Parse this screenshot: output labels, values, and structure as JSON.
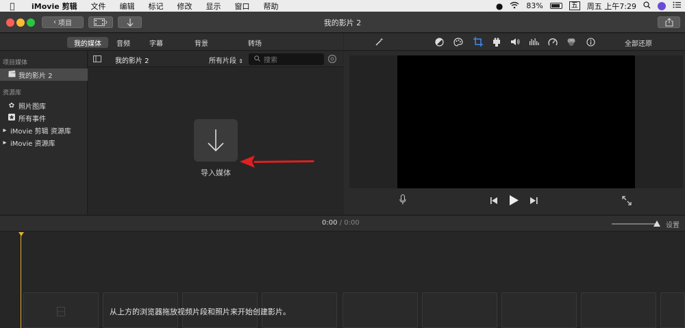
{
  "menubar": {
    "app": "iMovie 剪辑",
    "items": [
      "文件",
      "编辑",
      "标记",
      "修改",
      "显示",
      "窗口",
      "帮助"
    ],
    "battery": "83%",
    "ime": "五",
    "clock": "周五 上午7:29"
  },
  "titlebar": {
    "back_label": "项目",
    "title": "我的影片 2"
  },
  "tabs": [
    "我的媒体",
    "音频",
    "字幕",
    "背景",
    "转场"
  ],
  "viewer_toolbar": {
    "reset_all": "全部还原"
  },
  "sidebar": {
    "section_project": "项目媒体",
    "project_item": "我的影片 2",
    "section_library": "资源库",
    "library_items": [
      "照片图库",
      "所有事件"
    ],
    "collapsible_items": [
      "iMovie 剪辑 资源库",
      "iMovie 资源库"
    ]
  },
  "browser": {
    "title": "我的影片 2",
    "filter": "所有片段",
    "search_placeholder": "搜索",
    "import_label": "导入媒体"
  },
  "timeline": {
    "timecode_current": "0:00",
    "timecode_sep": "/",
    "timecode_total": "0:00",
    "settings": "设置",
    "hint": "从上方的浏览器拖放视频片段和照片来开始创建影片。"
  },
  "colors": {
    "accent": "#3d8cf0",
    "annotation_arrow": "#e02020",
    "playhead": "#e0b030"
  }
}
